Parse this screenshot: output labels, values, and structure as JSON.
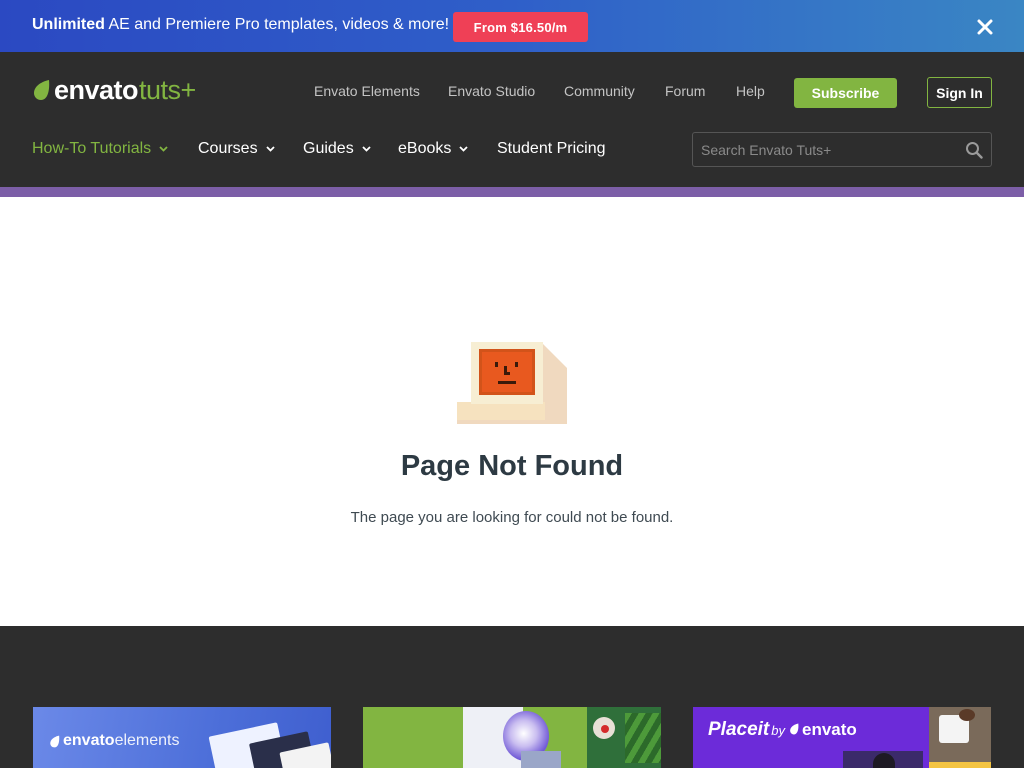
{
  "promo": {
    "text_bold": "Unlimited",
    "text_rest": " AE and Premiere Pro templates, videos & more!",
    "cta": "From $16.50/m",
    "close_icon": "close-icon"
  },
  "header": {
    "logo": {
      "envato": "envato",
      "tuts": "tuts+"
    },
    "top_links": [
      "Envato Elements",
      "Envato Studio",
      "Community",
      "Forum",
      "Help"
    ],
    "subscribe": "Subscribe",
    "sign_in": "Sign In",
    "nav": [
      "How-To Tutorials",
      "Courses",
      "Guides",
      "eBooks",
      "Student Pricing"
    ],
    "search": {
      "placeholder": "Search Envato Tuts+"
    }
  },
  "main": {
    "title": "Page Not Found",
    "message": "The page you are looking for could not be found."
  },
  "footer": {
    "cards": [
      {
        "brand": "envatoelements",
        "brand_bold": "envato",
        "brand_light": "elements"
      },
      {
        "brand": ""
      },
      {
        "brand_main": "Placeit",
        "brand_by": "by",
        "brand_env": "envato"
      }
    ]
  },
  "colors": {
    "brand_green": "#82b541",
    "header_bg": "#2d2d2d",
    "accent_purple": "#7c5ea7",
    "promo_cta": "#ef4056",
    "placeit_purple": "#6c2bd9"
  }
}
